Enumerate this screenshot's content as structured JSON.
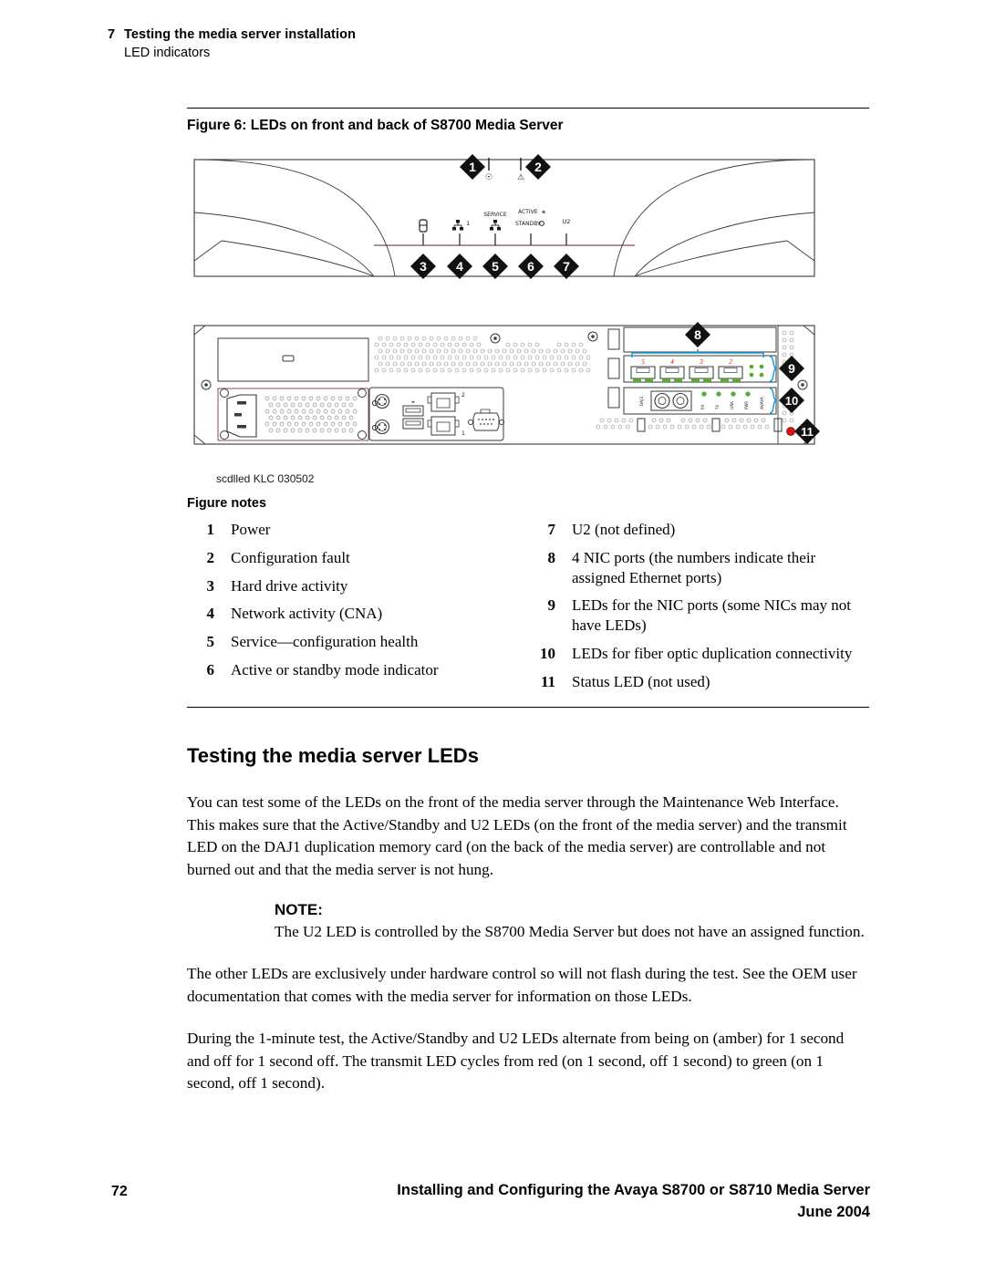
{
  "header": {
    "chapter_number": "7",
    "chapter_title": "Testing the media server installation",
    "subtitle": "LED indicators"
  },
  "figure": {
    "caption": "Figure 6: LEDs on front and back of S8700 Media Server",
    "art_credit": "scdlled KLC 030502",
    "front_panel": {
      "callouts_top": [
        "1",
        "2"
      ],
      "callouts_bottom": [
        "3",
        "4",
        "5",
        "6",
        "7"
      ],
      "labels": {
        "service": "SERVICE",
        "active": "ACTIVE",
        "standby": "STANDBY",
        "u2": "U2",
        "nic_port_number": "1"
      }
    },
    "back_panel": {
      "callouts": [
        "8",
        "9",
        "10",
        "11"
      ],
      "nic_port_numbers": [
        "5",
        "4",
        "3",
        "2"
      ],
      "onboard_nic_numbers": [
        "2",
        "1"
      ],
      "status_led_color": "#d81414",
      "bracket_color": "#1a9ee0",
      "nic_number_color": "#d81414",
      "led_green": "#4fb84f"
    }
  },
  "figure_notes": {
    "title": "Figure notes",
    "left": [
      {
        "num": "1",
        "text": "Power"
      },
      {
        "num": "2",
        "text": "Configuration fault"
      },
      {
        "num": "3",
        "text": "Hard drive activity"
      },
      {
        "num": "4",
        "text": "Network activity (CNA)"
      },
      {
        "num": "5",
        "text": "Service—configuration health"
      },
      {
        "num": "6",
        "text": "Active or standby mode indicator"
      }
    ],
    "right": [
      {
        "num": "7",
        "text": "U2 (not defined)"
      },
      {
        "num": "8",
        "text": "4 NIC ports (the numbers indicate their assigned Ethernet ports)"
      },
      {
        "num": "9",
        "text": "LEDs for the NIC ports (some NICs may not have LEDs)"
      },
      {
        "num": "10",
        "text": "LEDs for fiber optic duplication connectivity"
      },
      {
        "num": "11",
        "text": "Status LED (not used)"
      }
    ]
  },
  "section": {
    "title": "Testing the media server LEDs",
    "paragraph1": "You can test some of the LEDs on the front of the media server through the Maintenance Web Interface. This makes sure that the Active/Standby and U2 LEDs (on the front of the media server) and the transmit LED on the DAJ1 duplication memory card (on the back of the media server) are controllable and not burned out and that the media server is not hung.",
    "note_label": "NOTE:",
    "note_text": "The U2 LED is controlled by the S8700 Media Server but does not have an assigned function.",
    "paragraph2": "The other LEDs are exclusively under hardware control so will not flash during the test. See the OEM user documentation that comes with the media server for information on those LEDs.",
    "paragraph3": "During the 1-minute test, the Active/Standby and U2 LEDs alternate from being on (amber) for 1 second and off for 1 second off. The transmit LED cycles from red (on 1 second, off 1 second) to green (on 1 second, off 1 second)."
  },
  "footer": {
    "page_number": "72",
    "doc_title": "Installing and Configuring the Avaya S8700 or S8710 Media Server",
    "date": "June 2004"
  }
}
